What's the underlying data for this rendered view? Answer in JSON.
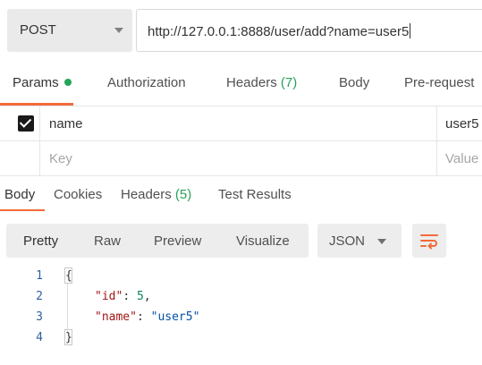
{
  "request": {
    "method": "POST",
    "url": "http://127.0.0.1:8888/user/add?name=user5"
  },
  "request_tabs": {
    "params_label": "Params",
    "authorization_label": "Authorization",
    "headers_label": "Headers",
    "headers_count": "(7)",
    "body_label": "Body",
    "prerequest_label": "Pre-request"
  },
  "params": {
    "rows": [
      {
        "key": "name",
        "value": "user5",
        "checked": true
      }
    ],
    "placeholder_key": "Key",
    "placeholder_value": "Value"
  },
  "response_tabs": {
    "body_label": "Body",
    "cookies_label": "Cookies",
    "headers_label": "Headers",
    "headers_count": "(5)",
    "test_results_label": "Test Results"
  },
  "format_toolbar": {
    "pretty_label": "Pretty",
    "raw_label": "Raw",
    "preview_label": "Preview",
    "visualize_label": "Visualize",
    "format_selected": "JSON"
  },
  "code": {
    "line_numbers": [
      "1",
      "2",
      "3",
      "4"
    ],
    "open_brace": "{",
    "line2": {
      "key": "\"id\"",
      "colon": ": ",
      "value": "5",
      "comma": ","
    },
    "line3": {
      "key": "\"name\"",
      "colon": ": ",
      "value": "\"user5\""
    },
    "close_brace": "}"
  },
  "colors": {
    "accent": "#f26b3a",
    "count_green": "#27a35a",
    "json_key": "#a31515",
    "json_number": "#098658",
    "json_string": "#0451a5",
    "line_number": "#2e5fa0"
  },
  "icons": {
    "method_caret": "chevron-down-icon",
    "format_caret": "chevron-down-icon",
    "wrap": "wrap-lines-icon",
    "checkbox": "checkbox-checked-icon"
  }
}
